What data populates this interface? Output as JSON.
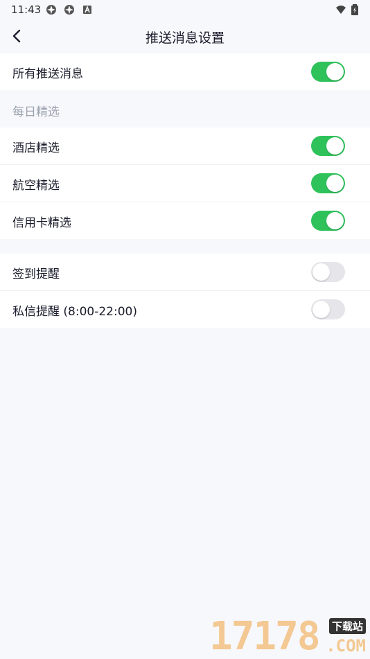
{
  "status_bar": {
    "time": "11:43",
    "icons": [
      "app-icon",
      "app-icon",
      "a-icon",
      "wifi-icon",
      "battery-icon"
    ]
  },
  "nav": {
    "title": "推送消息设置",
    "back_icon": "chevron-left-icon"
  },
  "all_push": {
    "label": "所有推送消息",
    "on": true
  },
  "daily": {
    "header": "每日精选",
    "items": [
      {
        "label": "酒店精选",
        "on": true
      },
      {
        "label": "航空精选",
        "on": true
      },
      {
        "label": "信用卡精选",
        "on": true
      }
    ]
  },
  "reminders": {
    "items": [
      {
        "label": "签到提醒",
        "on": false
      },
      {
        "label": "私信提醒 (8:00-22:00)",
        "on": false
      }
    ]
  },
  "colors": {
    "toggle_on": "#2fc25b",
    "toggle_off": "#e5e5ea",
    "background": "#f7f8fc"
  },
  "watermark": {
    "digits": "17178",
    "cn": "下载站",
    "com": ".COM"
  }
}
